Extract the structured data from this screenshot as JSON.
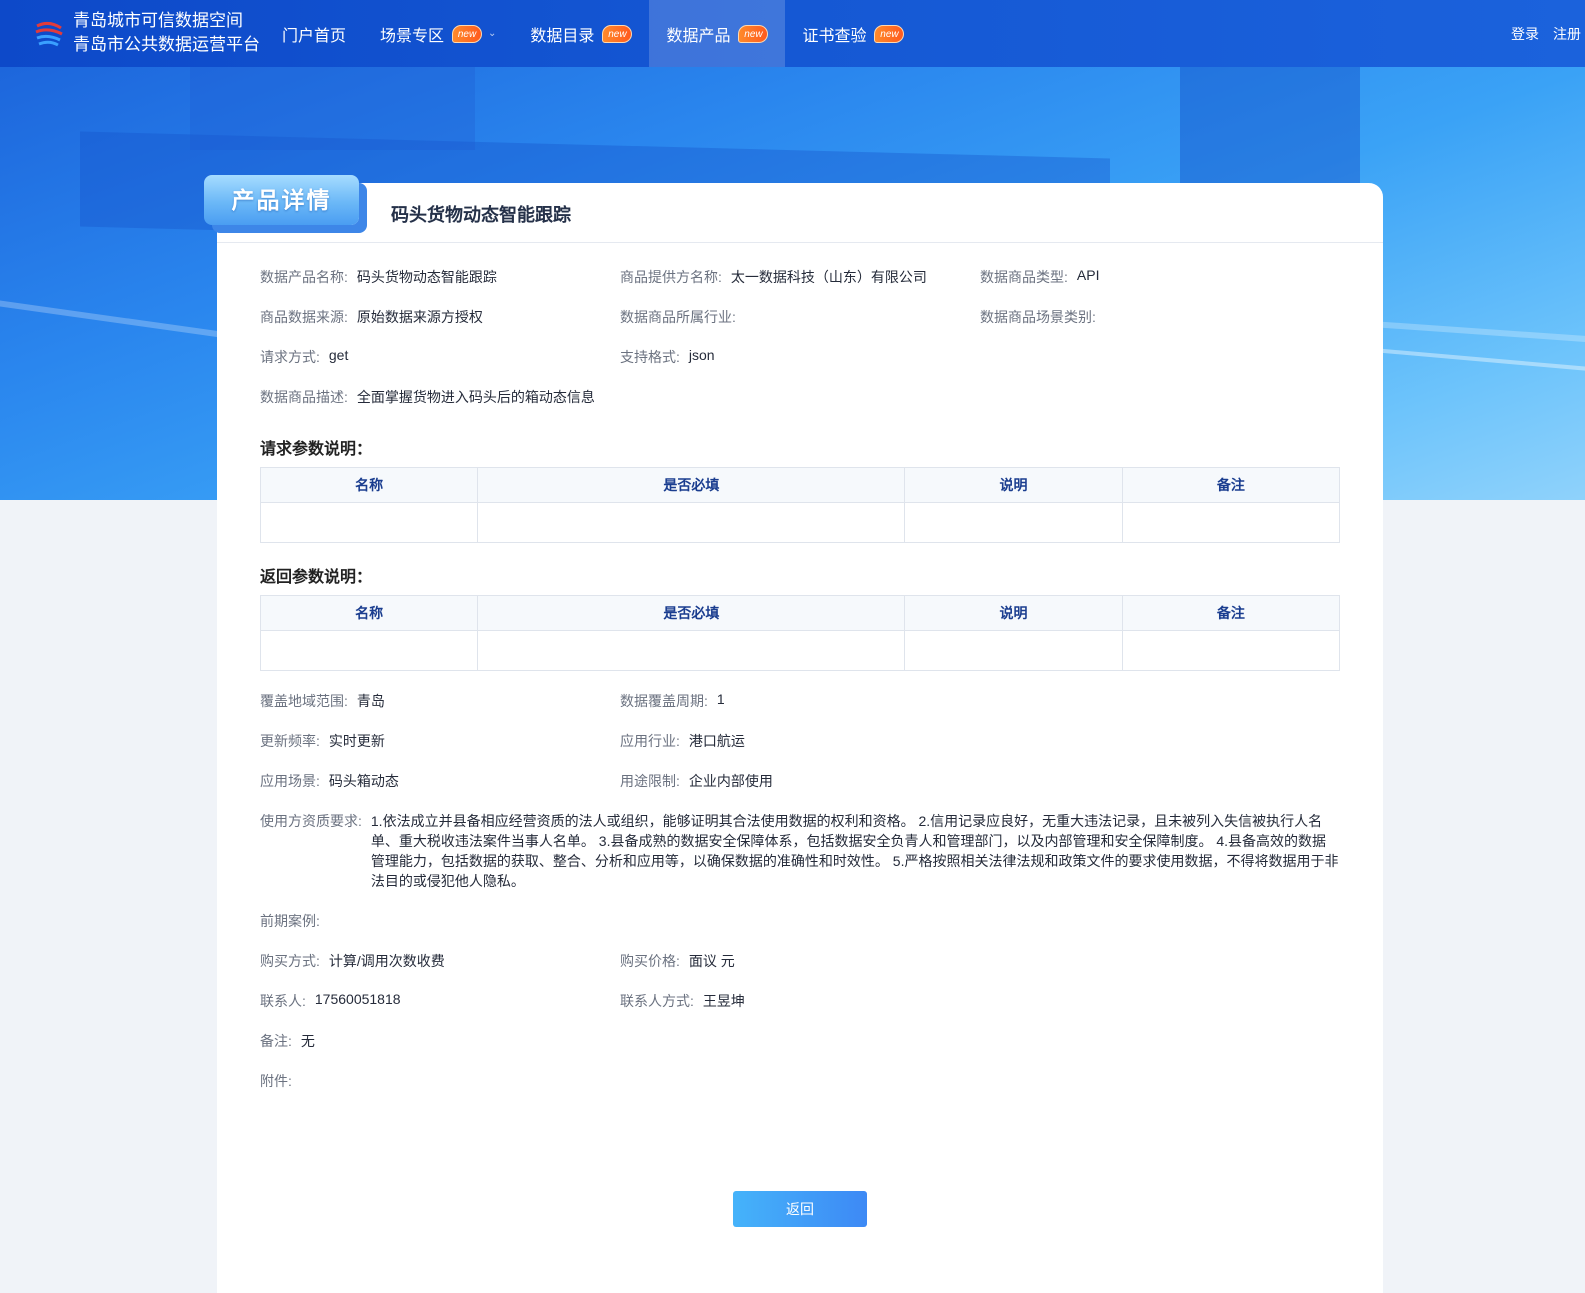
{
  "header": {
    "brand_line1": "青岛城市可信数据空间",
    "brand_line2": "青岛市公共数据运营平台",
    "nav": [
      {
        "label": "门户首页"
      },
      {
        "label": "场景专区",
        "badge": "new"
      },
      {
        "label": "数据目录",
        "badge": "new"
      },
      {
        "label": "数据产品",
        "badge": "new"
      },
      {
        "label": "证书查验",
        "badge": "new"
      }
    ],
    "login": "登录",
    "register": "注册"
  },
  "card": {
    "tab_label": "产品详情",
    "title": "码头货物动态智能跟踪"
  },
  "fields": {
    "product_name": {
      "label": "数据产品名称:",
      "value": "码头货物动态智能跟踪"
    },
    "provider": {
      "label": "商品提供方名称:",
      "value": "太一数据科技（山东）有限公司"
    },
    "type": {
      "label": "数据商品类型:",
      "value": "API"
    },
    "source": {
      "label": "商品数据来源:",
      "value": "原始数据来源方授权"
    },
    "industry": {
      "label": "数据商品所属行业:",
      "value": ""
    },
    "scene_category": {
      "label": "数据商品场景类别:",
      "value": ""
    },
    "method": {
      "label": "请求方式:",
      "value": "get"
    },
    "format": {
      "label": "支持格式:",
      "value": "json"
    },
    "description": {
      "label": "数据商品描述:",
      "value": "全面掌握货物进入码头后的箱动态信息"
    },
    "coverage_area": {
      "label": "覆盖地域范围:",
      "value": "青岛"
    },
    "coverage_period": {
      "label": "数据覆盖周期:",
      "value": "1"
    },
    "update_freq": {
      "label": "更新频率:",
      "value": "实时更新"
    },
    "app_industry": {
      "label": "应用行业:",
      "value": "港口航运"
    },
    "app_scene": {
      "label": "应用场景:",
      "value": "码头箱动态"
    },
    "usage_limit": {
      "label": "用途限制:",
      "value": "企业内部使用"
    },
    "qualification": {
      "label": "使用方资质要求:",
      "value": "1.依法成立并县备相应经营资质的法人或组织，能够证明其合法使用数据的权利和资格。 2.信用记录应良好，无重大违法记录，且未被列入失信被执行人名单、重大税收违法案件当事人名单。 3.县备成熟的数据安全保障体系，包括数据安全负青人和管理部门，以及内部管理和安全保障制度。 4.县备高效的数据管理能力，包括数据的获取、整合、分析和应用等，以确保数据的准确性和时效性。 5.严格按照相关法律法规和政策文件的要求使用数据，不得将数据用于非法目的或侵犯他人隐私。"
    },
    "cases": {
      "label": "前期案例:",
      "value": ""
    },
    "purchase_method": {
      "label": "购买方式:",
      "value": "计算/调用次数收费"
    },
    "purchase_price": {
      "label": "购买价格:",
      "value": "面议 元"
    },
    "contact": {
      "label": "联系人:",
      "value": "17560051818"
    },
    "contact_method": {
      "label": "联系人方式:",
      "value": "王昱坤"
    },
    "remark": {
      "label": "备注:",
      "value": "无"
    },
    "attachment": {
      "label": "附件:",
      "value": ""
    }
  },
  "request_params": {
    "title": "请求参数说明：",
    "columns": [
      "名称",
      "是否必填",
      "说明",
      "备注"
    ]
  },
  "response_params": {
    "title": "返回参数说明：",
    "columns": [
      "名称",
      "是否必填",
      "说明",
      "备注"
    ]
  },
  "back_button": "返回"
}
